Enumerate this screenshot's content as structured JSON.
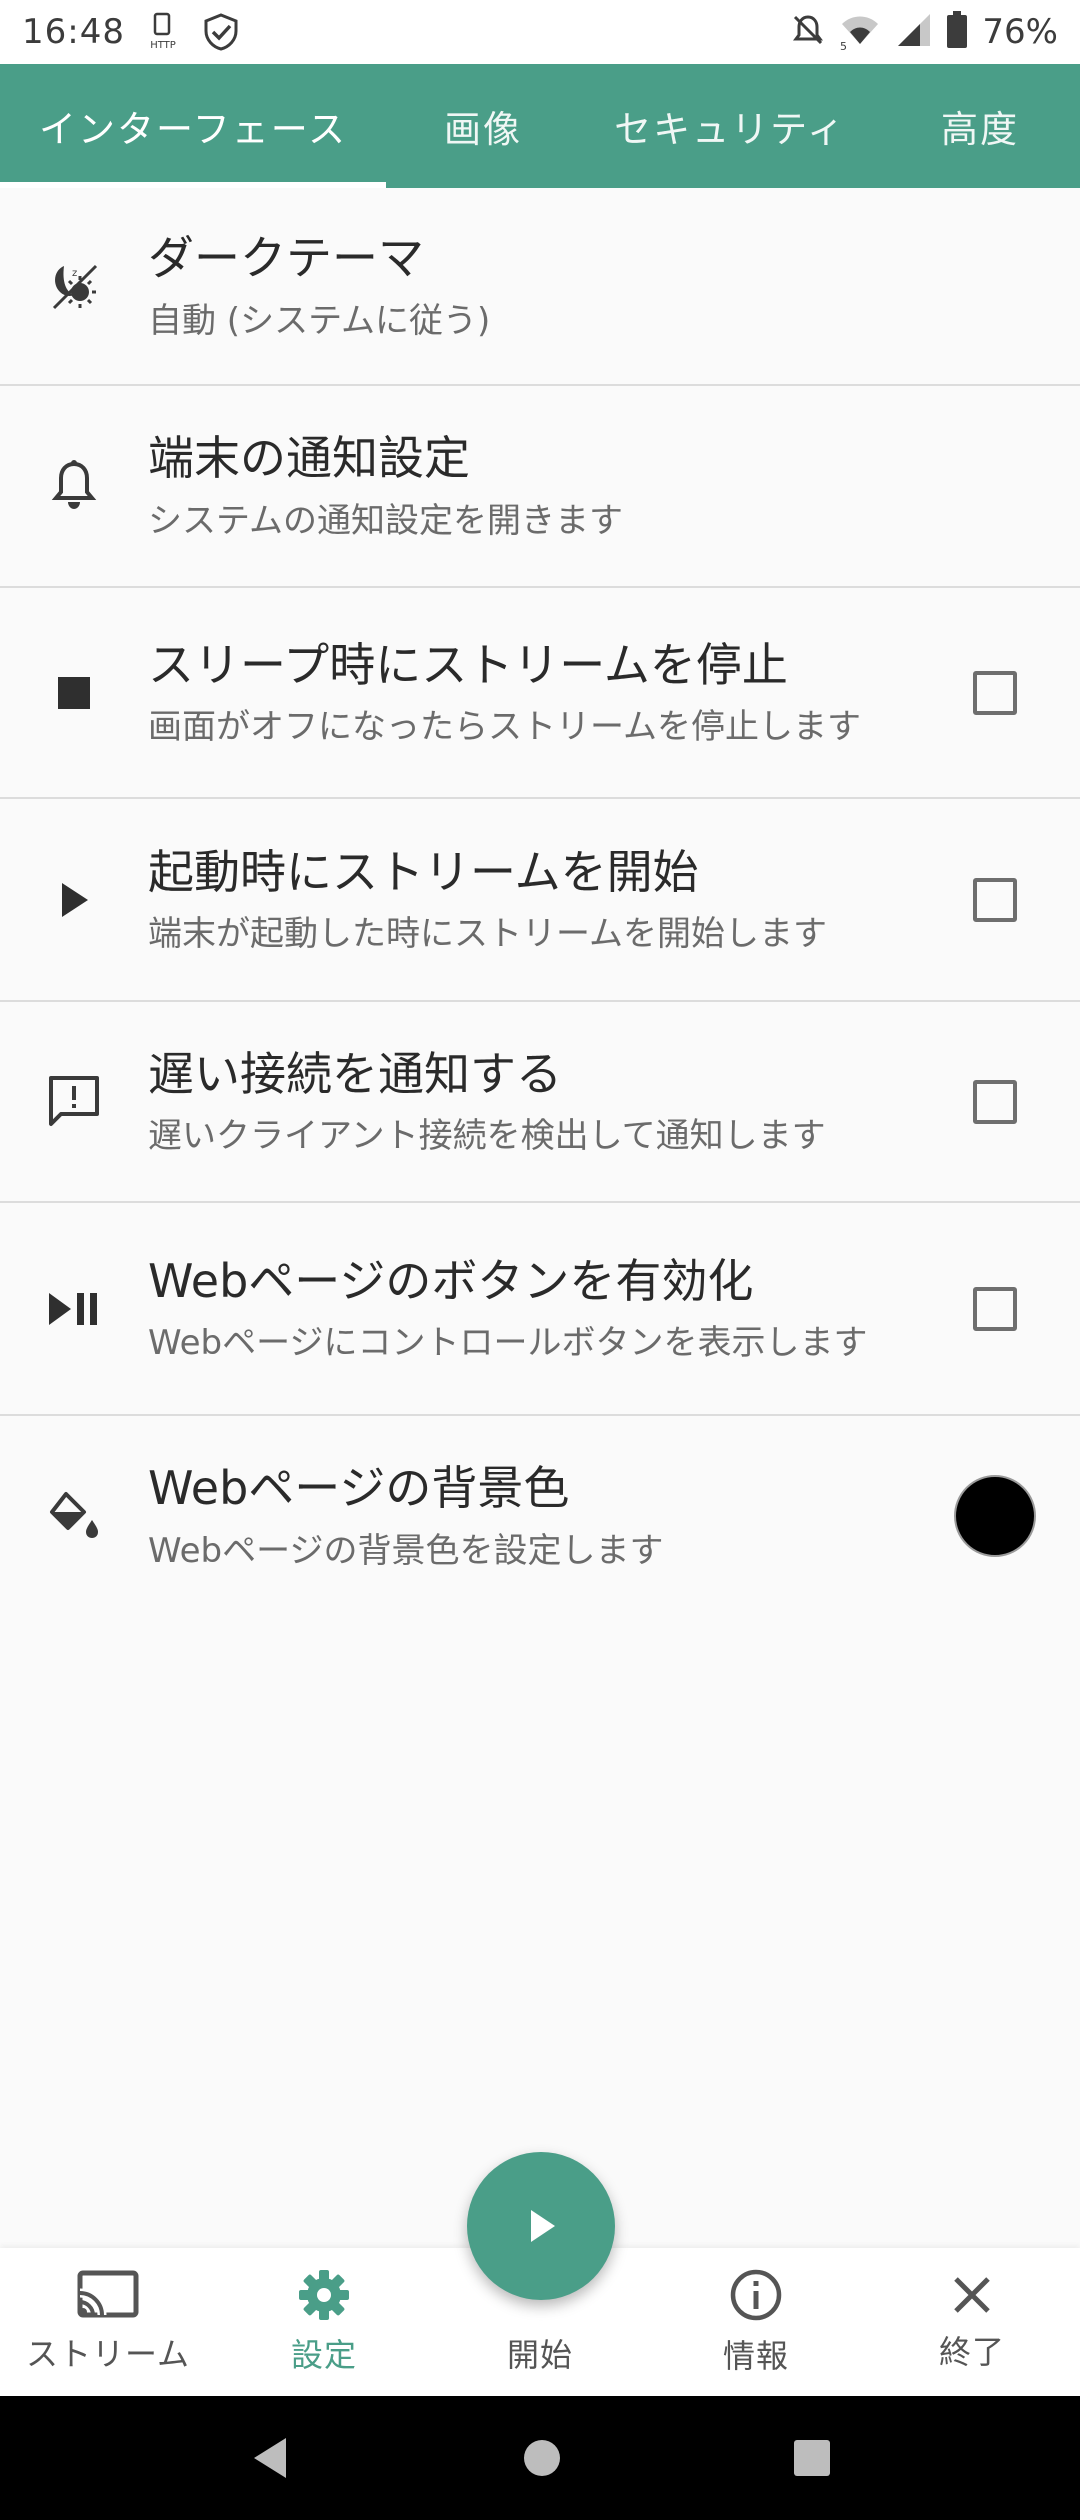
{
  "status_bar": {
    "time": "16:48",
    "http_label": "HTTP",
    "network_label": "5",
    "battery": "76%"
  },
  "tabs": [
    {
      "label": "インターフェース",
      "active": true
    },
    {
      "label": "画像",
      "active": false
    },
    {
      "label": "セキュリティ",
      "active": false
    },
    {
      "label": "高度",
      "active": false
    }
  ],
  "settings": [
    {
      "icon": "dark-theme-icon",
      "title": "ダークテーマ",
      "summary": "自動 (システムに従う)",
      "widget": "none"
    },
    {
      "icon": "bell-icon",
      "title": "端末の通知設定",
      "summary": "システムの通知設定を開きます",
      "widget": "none"
    },
    {
      "icon": "stop-icon",
      "title": "スリープ時にストリームを停止",
      "summary": "画面がオフになったらストリームを停止します",
      "widget": "checkbox",
      "checked": false
    },
    {
      "icon": "play-icon",
      "title": "起動時にストリームを開始",
      "summary": "端末が起動した時にストリームを開始します",
      "widget": "checkbox",
      "checked": false
    },
    {
      "icon": "feedback-icon",
      "title": "遅い接続を通知する",
      "summary": "遅いクライアント接続を検出して通知します",
      "widget": "checkbox",
      "checked": false
    },
    {
      "icon": "play-pause-icon",
      "title": "Webページのボタンを有効化",
      "summary": "Webページにコントロールボタンを表示します",
      "widget": "checkbox",
      "checked": false
    },
    {
      "icon": "paint-bucket-icon",
      "title": "Webページの背景色",
      "summary": "Webページの背景色を設定します",
      "widget": "color",
      "color": "#000000"
    }
  ],
  "bottom_nav": [
    {
      "icon": "cast-icon",
      "label": "ストリーム",
      "active": false
    },
    {
      "icon": "gear-icon",
      "label": "設定",
      "active": true
    },
    {
      "icon": "play-icon",
      "label": "開始",
      "active": false
    },
    {
      "icon": "info-icon",
      "label": "情報",
      "active": false
    },
    {
      "icon": "close-icon",
      "label": "終了",
      "active": false
    }
  ],
  "colors": {
    "accent": "#4a9e88",
    "background": "#fafafa"
  }
}
